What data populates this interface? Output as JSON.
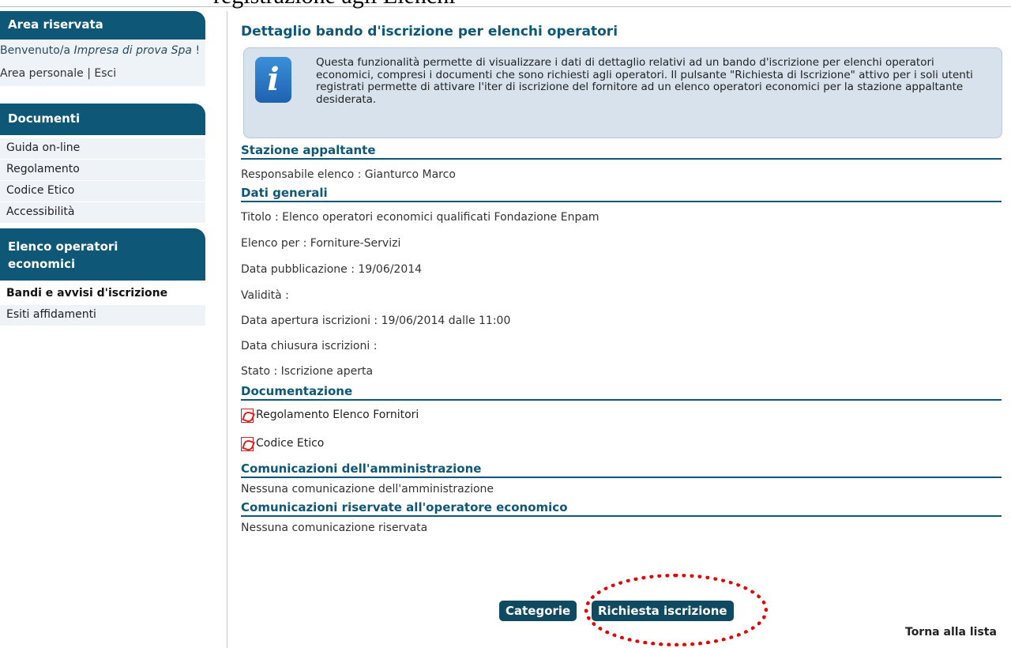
{
  "top_caption": "registrazione agli Elenchi",
  "sidebar": {
    "reserved_area": {
      "title": "Area riservata",
      "welcome_prefix": "Benvenuto/a ",
      "welcome_user": "Impresa di prova Spa",
      "welcome_suffix": " !",
      "personal_area": "Area personale",
      "separator": " | ",
      "logout": "Esci"
    },
    "documents": {
      "title": "Documenti",
      "items": [
        "Guida on-line",
        "Regolamento",
        "Codice Etico",
        "Accessibilità"
      ]
    },
    "operators": {
      "title_line1": "Elenco operatori",
      "title_line2": "economici",
      "items": [
        "Bandi e avvisi d'iscrizione",
        "Esiti affidamenti"
      ]
    }
  },
  "main": {
    "title": "Dettaglio bando d'iscrizione per elenchi operatori",
    "info_icon": "info-icon",
    "info_text": "Questa funzionalità permette di visualizzare i dati di dettaglio relativi ad un bando d'iscrizione per elenchi operatori economici, compresi i documenti che sono richiesti agli operatori. Il pulsante \"Richiesta di Iscrizione\" attivo per i soli utenti registrati permette di attivare l'iter di iscrizione del fornitore ad un elenco operatori economici per la stazione appaltante desiderata.",
    "stazione": {
      "title": "Stazione appaltante",
      "responsabile": "Responsabile elenco : Gianturco Marco"
    },
    "dati_generali": {
      "title": "Dati generali",
      "titolo": "Titolo : Elenco operatori economici qualificati Fondazione Enpam",
      "elenco_per": "Elenco per : Forniture-Servizi",
      "data_pubblicazione": "Data pubblicazione : 19/06/2014",
      "validita": "Validità :",
      "data_apertura": "Data apertura iscrizioni : 19/06/2014 dalle 11:00",
      "data_chiusura": "Data chiusura iscrizioni :",
      "stato": "Stato : Iscrizione aperta"
    },
    "documentazione": {
      "title": "Documentazione",
      "docs": [
        "Regolamento Elenco Fornitori",
        "Codice Etico"
      ]
    },
    "comunicazioni_amm": {
      "title": "Comunicazioni dell'amministrazione",
      "text": "Nessuna comunicazione dell'amministrazione"
    },
    "comunicazioni_ris": {
      "title": "Comunicazioni riservate all'operatore economico",
      "text": "Nessuna comunicazione riservata"
    },
    "buttons": {
      "categorie": "Categorie",
      "richiesta": "Richiesta iscrizione"
    },
    "back_link": "Torna alla lista"
  },
  "colors": {
    "accent": "#0f5776",
    "button": "#0f4a60",
    "highlight": "#e30000",
    "info_box": "#d7e2ec"
  }
}
